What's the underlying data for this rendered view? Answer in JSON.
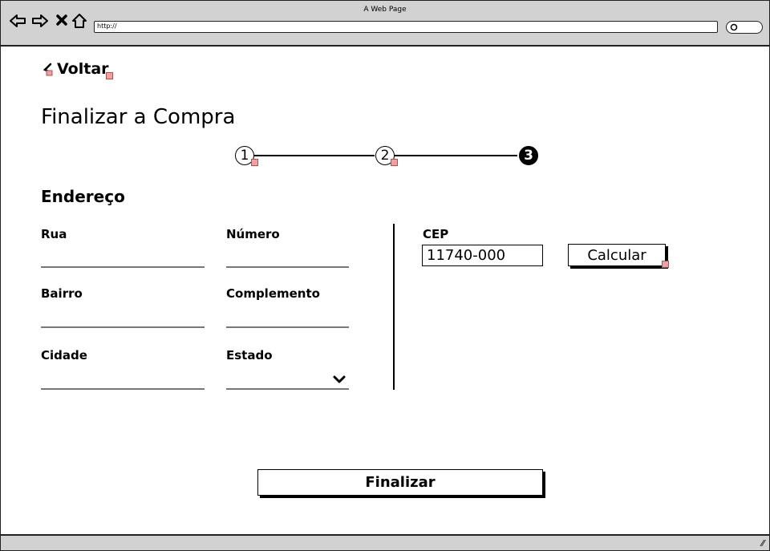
{
  "browser": {
    "window_title": "A Web Page",
    "url": "http://"
  },
  "page": {
    "back_label": "Voltar",
    "title": "Finalizar a Compra",
    "steps": [
      "1",
      "2",
      "3"
    ],
    "active_step": 3
  },
  "address": {
    "section_title": "Endereço",
    "street_label": "Rua",
    "number_label": "Número",
    "neighborhood_label": "Bairro",
    "complement_label": "Complemento",
    "city_label": "Cidade",
    "state_label": "Estado"
  },
  "cep": {
    "label": "CEP",
    "value": "11740-000",
    "calculate_label": "Calcular"
  },
  "actions": {
    "finish_label": "Finalizar"
  }
}
